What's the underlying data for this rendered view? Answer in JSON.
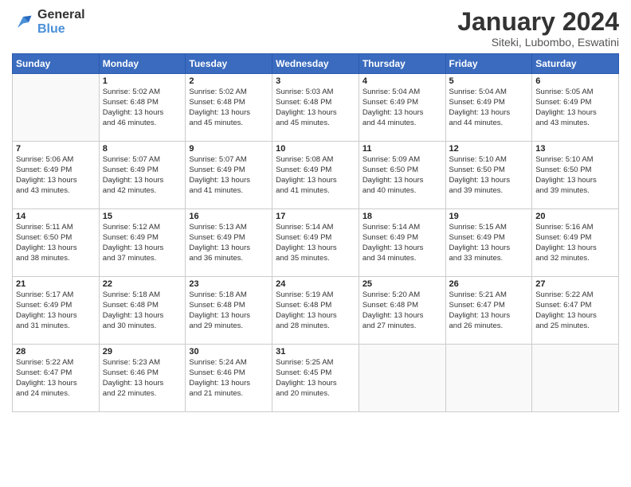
{
  "logo": {
    "line1": "General",
    "line2": "Blue"
  },
  "title": "January 2024",
  "subtitle": "Siteki, Lubombo, Eswatini",
  "days_header": [
    "Sunday",
    "Monday",
    "Tuesday",
    "Wednesday",
    "Thursday",
    "Friday",
    "Saturday"
  ],
  "weeks": [
    [
      {
        "day": "",
        "info": ""
      },
      {
        "day": "1",
        "info": "Sunrise: 5:02 AM\nSunset: 6:48 PM\nDaylight: 13 hours\nand 46 minutes."
      },
      {
        "day": "2",
        "info": "Sunrise: 5:02 AM\nSunset: 6:48 PM\nDaylight: 13 hours\nand 45 minutes."
      },
      {
        "day": "3",
        "info": "Sunrise: 5:03 AM\nSunset: 6:48 PM\nDaylight: 13 hours\nand 45 minutes."
      },
      {
        "day": "4",
        "info": "Sunrise: 5:04 AM\nSunset: 6:49 PM\nDaylight: 13 hours\nand 44 minutes."
      },
      {
        "day": "5",
        "info": "Sunrise: 5:04 AM\nSunset: 6:49 PM\nDaylight: 13 hours\nand 44 minutes."
      },
      {
        "day": "6",
        "info": "Sunrise: 5:05 AM\nSunset: 6:49 PM\nDaylight: 13 hours\nand 43 minutes."
      }
    ],
    [
      {
        "day": "7",
        "info": "Sunrise: 5:06 AM\nSunset: 6:49 PM\nDaylight: 13 hours\nand 43 minutes."
      },
      {
        "day": "8",
        "info": "Sunrise: 5:07 AM\nSunset: 6:49 PM\nDaylight: 13 hours\nand 42 minutes."
      },
      {
        "day": "9",
        "info": "Sunrise: 5:07 AM\nSunset: 6:49 PM\nDaylight: 13 hours\nand 41 minutes."
      },
      {
        "day": "10",
        "info": "Sunrise: 5:08 AM\nSunset: 6:49 PM\nDaylight: 13 hours\nand 41 minutes."
      },
      {
        "day": "11",
        "info": "Sunrise: 5:09 AM\nSunset: 6:50 PM\nDaylight: 13 hours\nand 40 minutes."
      },
      {
        "day": "12",
        "info": "Sunrise: 5:10 AM\nSunset: 6:50 PM\nDaylight: 13 hours\nand 39 minutes."
      },
      {
        "day": "13",
        "info": "Sunrise: 5:10 AM\nSunset: 6:50 PM\nDaylight: 13 hours\nand 39 minutes."
      }
    ],
    [
      {
        "day": "14",
        "info": "Sunrise: 5:11 AM\nSunset: 6:50 PM\nDaylight: 13 hours\nand 38 minutes."
      },
      {
        "day": "15",
        "info": "Sunrise: 5:12 AM\nSunset: 6:49 PM\nDaylight: 13 hours\nand 37 minutes."
      },
      {
        "day": "16",
        "info": "Sunrise: 5:13 AM\nSunset: 6:49 PM\nDaylight: 13 hours\nand 36 minutes."
      },
      {
        "day": "17",
        "info": "Sunrise: 5:14 AM\nSunset: 6:49 PM\nDaylight: 13 hours\nand 35 minutes."
      },
      {
        "day": "18",
        "info": "Sunrise: 5:14 AM\nSunset: 6:49 PM\nDaylight: 13 hours\nand 34 minutes."
      },
      {
        "day": "19",
        "info": "Sunrise: 5:15 AM\nSunset: 6:49 PM\nDaylight: 13 hours\nand 33 minutes."
      },
      {
        "day": "20",
        "info": "Sunrise: 5:16 AM\nSunset: 6:49 PM\nDaylight: 13 hours\nand 32 minutes."
      }
    ],
    [
      {
        "day": "21",
        "info": "Sunrise: 5:17 AM\nSunset: 6:49 PM\nDaylight: 13 hours\nand 31 minutes."
      },
      {
        "day": "22",
        "info": "Sunrise: 5:18 AM\nSunset: 6:48 PM\nDaylight: 13 hours\nand 30 minutes."
      },
      {
        "day": "23",
        "info": "Sunrise: 5:18 AM\nSunset: 6:48 PM\nDaylight: 13 hours\nand 29 minutes."
      },
      {
        "day": "24",
        "info": "Sunrise: 5:19 AM\nSunset: 6:48 PM\nDaylight: 13 hours\nand 28 minutes."
      },
      {
        "day": "25",
        "info": "Sunrise: 5:20 AM\nSunset: 6:48 PM\nDaylight: 13 hours\nand 27 minutes."
      },
      {
        "day": "26",
        "info": "Sunrise: 5:21 AM\nSunset: 6:47 PM\nDaylight: 13 hours\nand 26 minutes."
      },
      {
        "day": "27",
        "info": "Sunrise: 5:22 AM\nSunset: 6:47 PM\nDaylight: 13 hours\nand 25 minutes."
      }
    ],
    [
      {
        "day": "28",
        "info": "Sunrise: 5:22 AM\nSunset: 6:47 PM\nDaylight: 13 hours\nand 24 minutes."
      },
      {
        "day": "29",
        "info": "Sunrise: 5:23 AM\nSunset: 6:46 PM\nDaylight: 13 hours\nand 22 minutes."
      },
      {
        "day": "30",
        "info": "Sunrise: 5:24 AM\nSunset: 6:46 PM\nDaylight: 13 hours\nand 21 minutes."
      },
      {
        "day": "31",
        "info": "Sunrise: 5:25 AM\nSunset: 6:45 PM\nDaylight: 13 hours\nand 20 minutes."
      },
      {
        "day": "",
        "info": ""
      },
      {
        "day": "",
        "info": ""
      },
      {
        "day": "",
        "info": ""
      }
    ]
  ]
}
